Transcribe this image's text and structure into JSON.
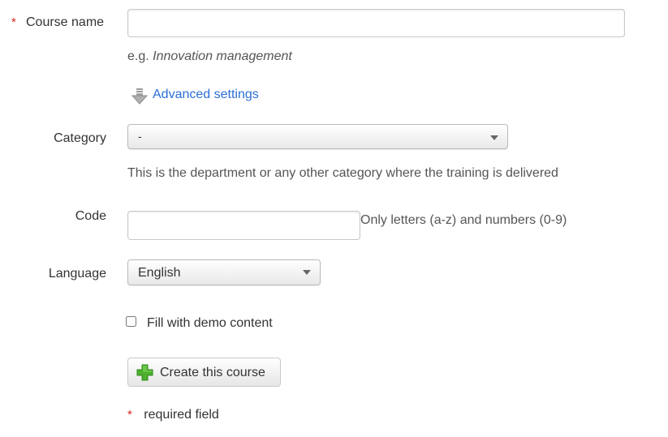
{
  "form": {
    "course_name": {
      "label": "Course name",
      "required_mark": "*",
      "value": "",
      "help_prefix": "e.g.",
      "help_example": "Innovation management"
    },
    "advanced_settings": {
      "label": "Advanced settings",
      "icon": "arrow-down-icon"
    },
    "category": {
      "label": "Category",
      "selected": "-",
      "help": "This is the department or any other category where the training is delivered"
    },
    "code": {
      "label": "Code",
      "value": "",
      "help": "Only letters (a-z) and numbers (0-9)"
    },
    "language": {
      "label": "Language",
      "selected": "English"
    },
    "demo_content": {
      "label": "Fill with demo content",
      "checked": false
    },
    "submit": {
      "label": "Create this course",
      "icon": "plus-icon",
      "icon_color": "#4caf2e"
    },
    "required_note": {
      "mark": "*",
      "text": "required field"
    }
  }
}
